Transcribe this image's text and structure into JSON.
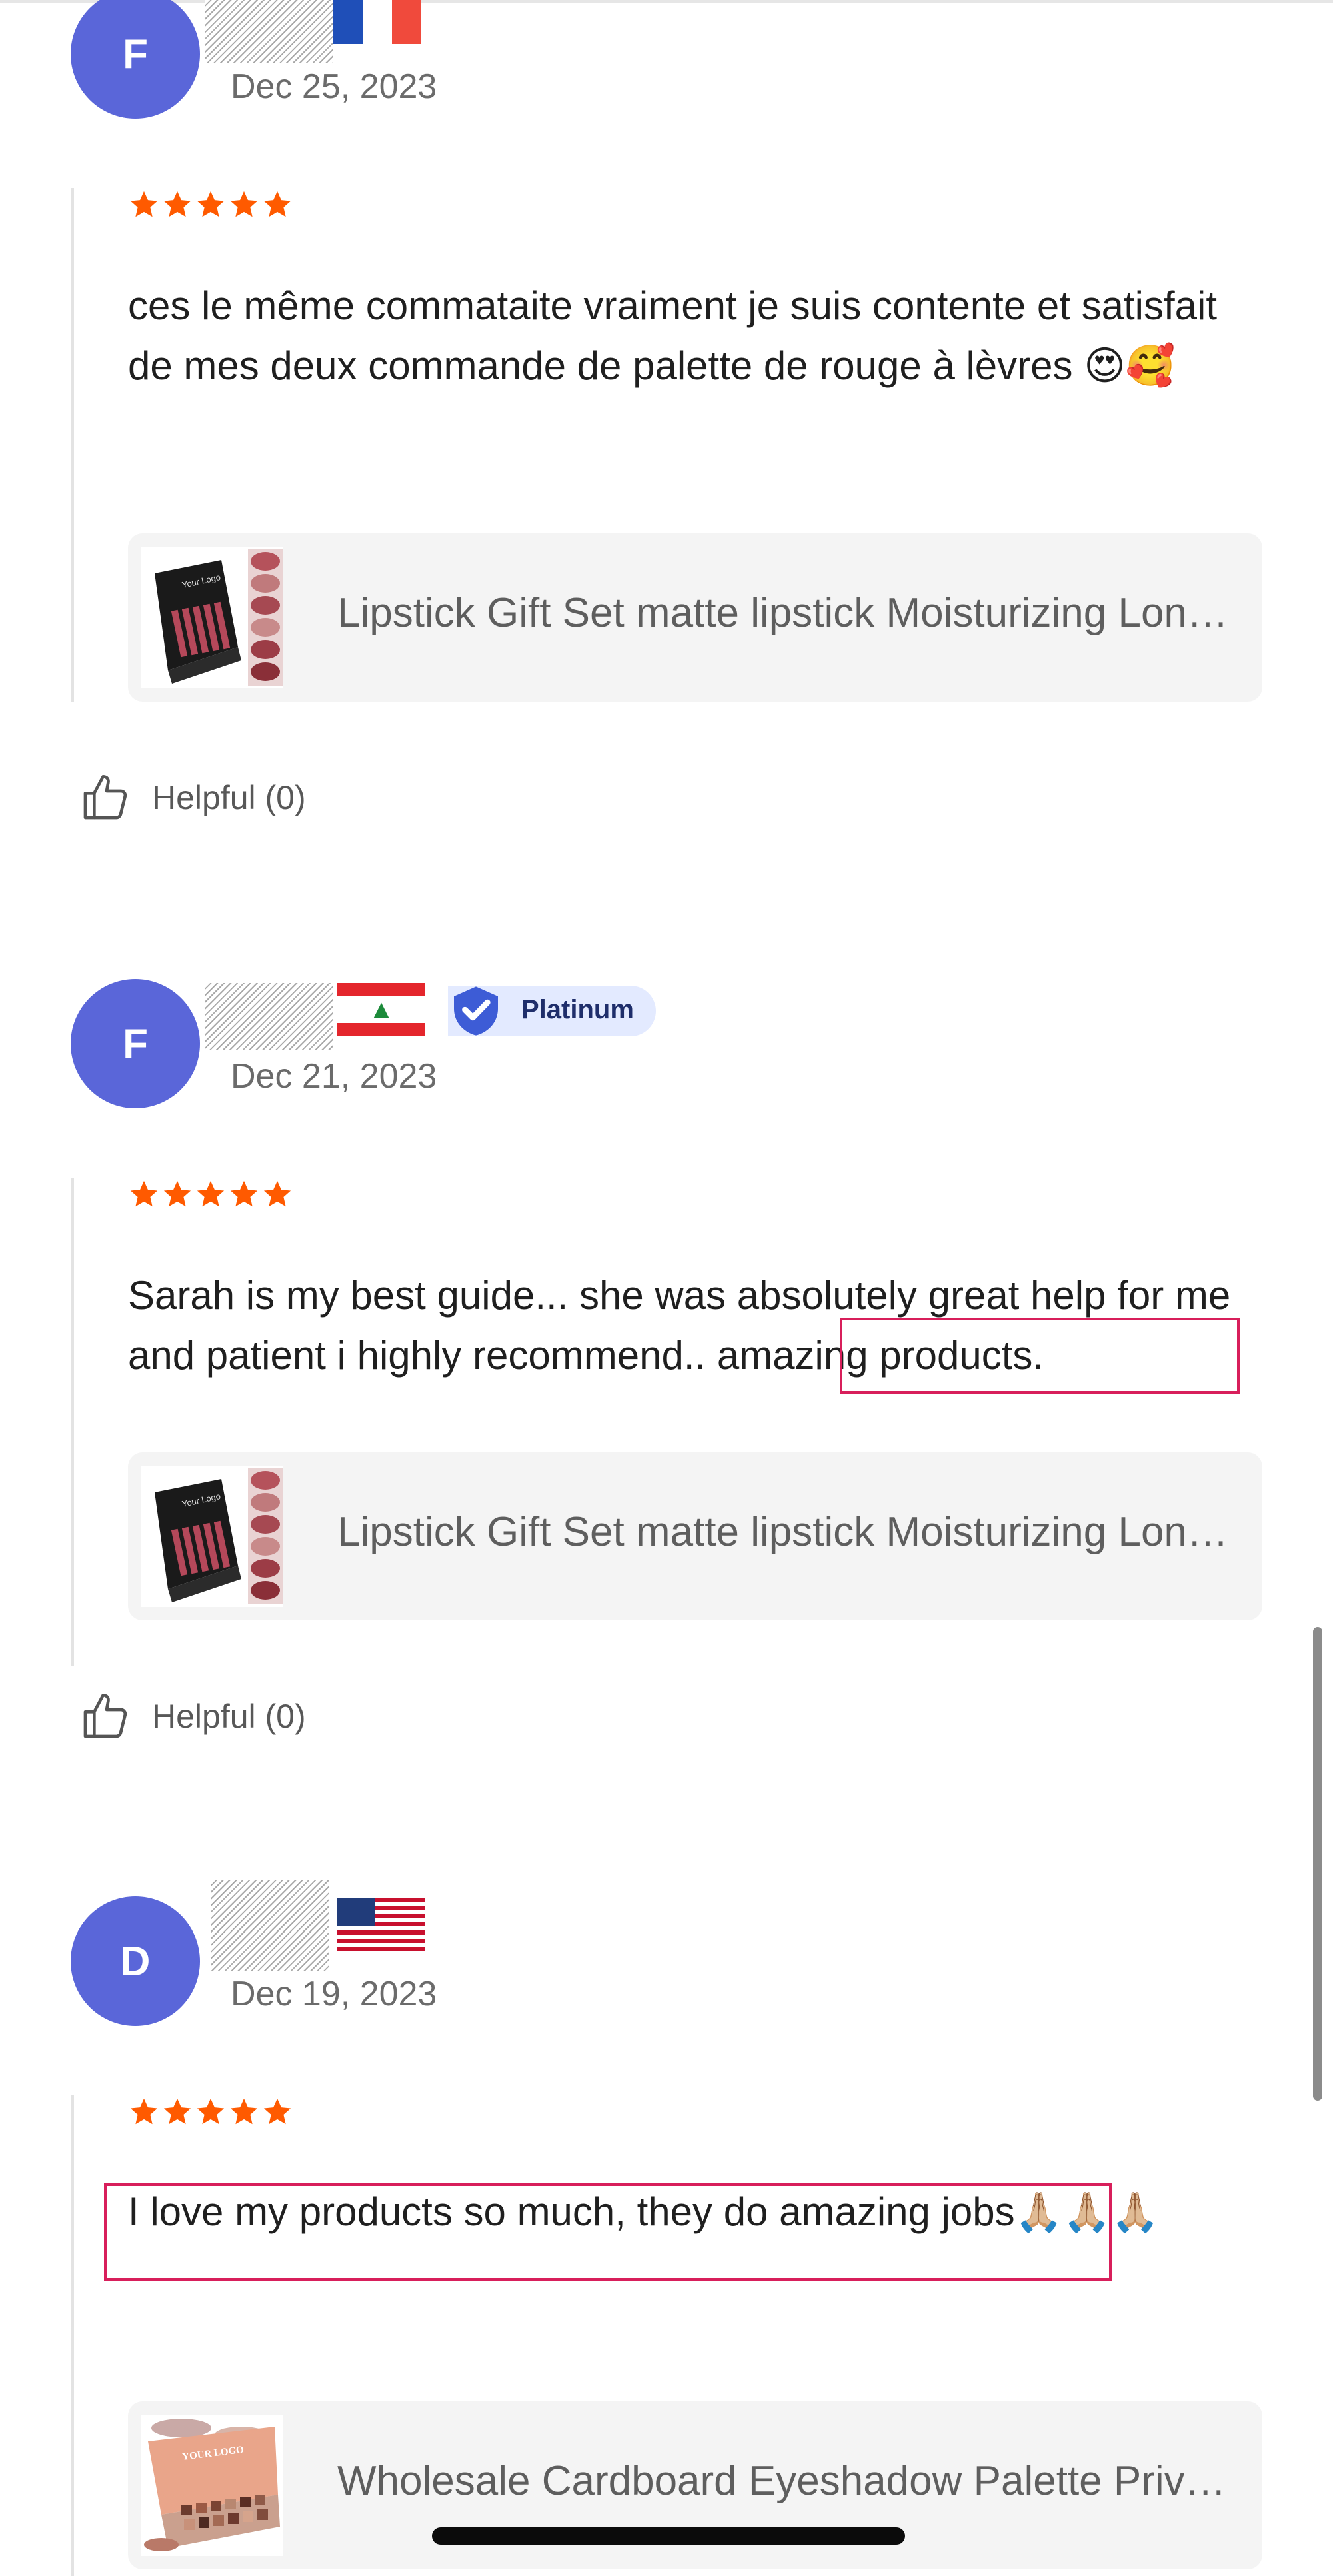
{
  "reviews": [
    {
      "avatar_letter": "F",
      "country_flag": "France",
      "badge": "",
      "date": "Dec 25, 2023",
      "rating": 5,
      "text": "ces le même commataite vraiment je suis contente et satisfait de mes deux commande de palette de rouge à lèvres 😍🥰",
      "product_title": "Lipstick Gift Set matte lipstick Moisturizing Long Lasting",
      "helpful_label": "Helpful (0)"
    },
    {
      "avatar_letter": "F",
      "country_flag": "Lebanon",
      "badge": "Platinum",
      "date": "Dec 21, 2023",
      "rating": 5,
      "text_part1": "Sarah is my best guide... she was absolutely great help for me and patient i highly recommend..",
      "text_part2": " amazing products.",
      "product_title": "Lipstick Gift Set matte lipstick Moisturizing Long Lasting",
      "helpful_label": "Helpful (0)"
    },
    {
      "avatar_letter": "D",
      "country_flag": "United States",
      "badge": "",
      "date": "Dec 19, 2023",
      "rating": 5,
      "text_part1": "I love my products so much, they do amazing jobs",
      "text_part2": "🙏🏼🙏🏼🙏🏼",
      "product_title": "Wholesale Cardboard Eyeshadow Palette Private Label",
      "helpful_label": "Helpful (0)"
    }
  ],
  "thumbnails": {
    "lipstick_box_text": "Your Logo",
    "palette_text": "YOUR LOGO"
  },
  "colors": {
    "avatar": "#5a66d9",
    "star": "#ff5a00",
    "highlight_border": "#d81f5b",
    "badge_bg": "#e3eaff"
  },
  "icons": {
    "helpful": "thumbs-up-icon",
    "rating": "star-icon",
    "badge": "verified-shield-icon"
  }
}
